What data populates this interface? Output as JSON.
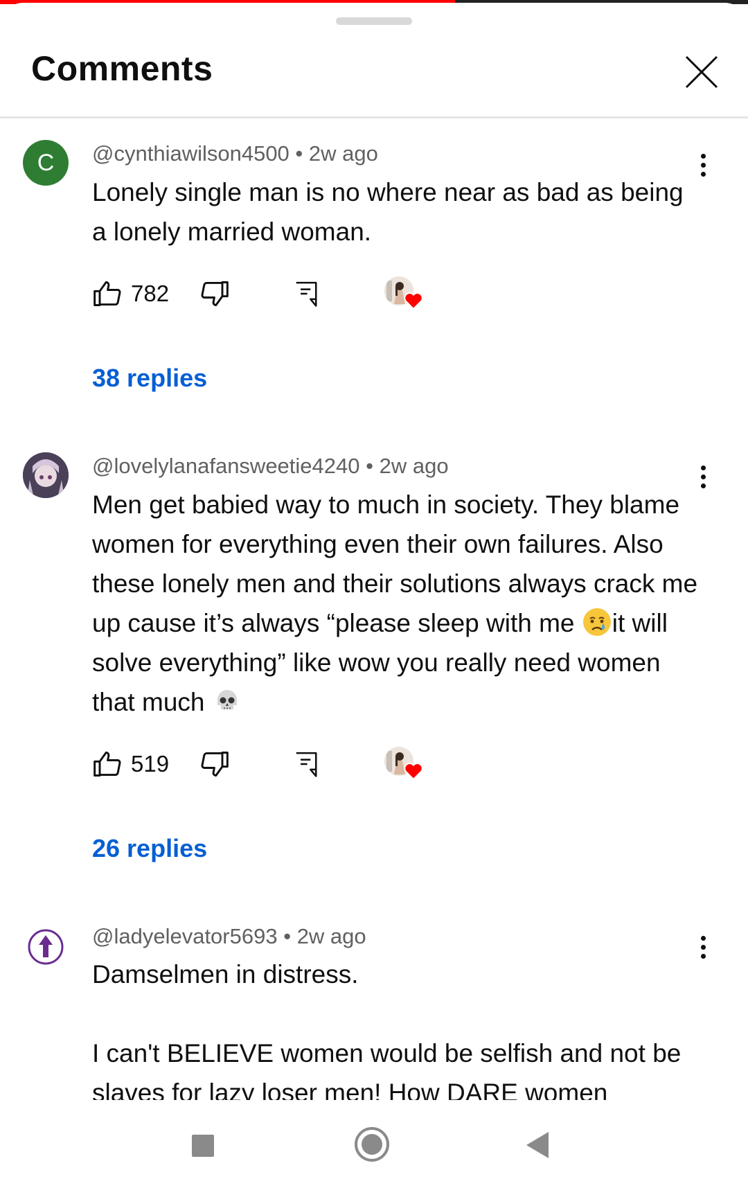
{
  "header": {
    "title": "Comments"
  },
  "comments": [
    {
      "avatar_letter": "C",
      "author": "@cynthiawilson4500",
      "time": "2w ago",
      "text": "Lonely single man is no where near as bad as being a lonely married woman.",
      "likes": "782",
      "replies": "38 replies"
    },
    {
      "author": "@lovelylanafansweetie4240",
      "time": "2w ago",
      "text_part1": "Men get babied way to much in society. They blame women for everything even their own failures. Also these lonely men and their solutions always crack me up cause it’s always “please sleep with me ",
      "text_part2": "it will solve everything” like wow you really need women that much ",
      "likes": "519",
      "replies": "26 replies"
    },
    {
      "author": "@ladyelevator5693",
      "time": "2w ago",
      "text_line1": "Damselmen in distress.",
      "text_line2": "I can't BELIEVE women would be selfish and not be slaves for lazy loser men! How DARE women"
    }
  ],
  "meta_separator": " • ",
  "colors": {
    "accent": "#065fd4",
    "progress": "#ff0000",
    "avatar_c": "#2e7d32",
    "heart": "#ff0000"
  },
  "icons": [
    "close-icon",
    "more-vert-icon",
    "thumb-up-icon",
    "thumb-down-icon",
    "reply-icon",
    "creator-heart-icon",
    "crying-face-emoji",
    "skull-emoji",
    "nav-square-icon",
    "nav-home-icon",
    "nav-back-icon"
  ]
}
